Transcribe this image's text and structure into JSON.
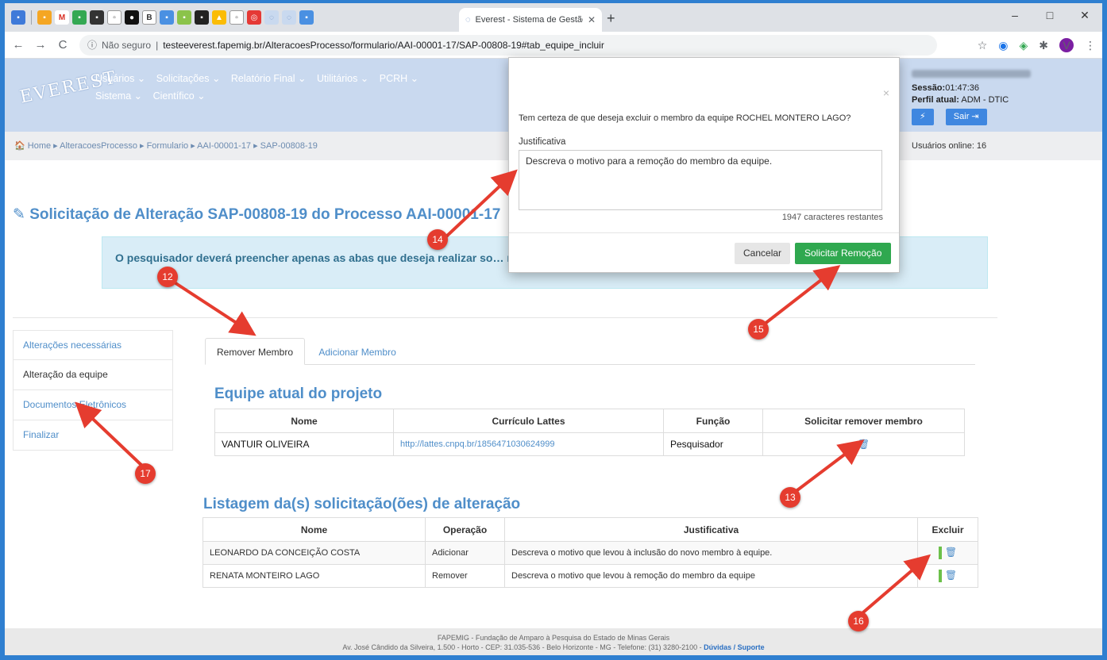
{
  "browser": {
    "active_tab_title": "Everest - Sistema de Gestão da F",
    "address_security": "Não seguro",
    "address_url": "testeeverest.fapemig.br/AlteracoesProcesso/formulario/AAI-00001-17/SAP-00808-19#tab_equipe_incluir",
    "profile_initial": "V",
    "new_tab": "+",
    "min": "–",
    "max": "□",
    "close": "✕"
  },
  "app": {
    "logo_text": "EVEREST",
    "menu_row1": [
      "Usuários ⌄",
      "Solicitações ⌄",
      "Relatório Final ⌄",
      "Utilitários ⌄",
      "PCRH ⌄"
    ],
    "menu_row2": [
      "Sistema ⌄",
      "Científico ⌄"
    ],
    "session_label": "Sessão:",
    "session_value": "01:47:36",
    "profile_label": "Perfil atual:",
    "profile_value": "ADM - DTIC",
    "bolt_button": "⚡",
    "logout_button": "Sair ⇥",
    "breadcrumb": "🏠 Home ▸ AlteracoesProcesso ▸ Formulario ▸ AAI-00001-17 ▸ SAP-00808-19",
    "online_users": "Usuários online: 16",
    "page_title": "✎ Solicitação de Alteração SAP-00808-19 do Processo AAI-00001-17",
    "alert_text": "O pesquisador deverá preencher apenas as abas que deseja realizar so… ma aba por solicitação de alteração."
  },
  "sidebar": {
    "items": [
      "Alterações necessárias",
      "Alteração da equipe",
      "Documentos Eletrônicos",
      "Finalizar"
    ]
  },
  "tabs": [
    "Remover Membro",
    "Adicionar Membro"
  ],
  "team": {
    "title": "Equipe atual do projeto",
    "headers": [
      "Nome",
      "Currículo Lattes",
      "Função",
      "Solicitar remover membro"
    ],
    "rows": [
      {
        "nome": "VANTUIR OLIVEIRA",
        "lattes": "http://lattes.cnpq.br/1856471030624999",
        "funcao": "Pesquisador"
      }
    ]
  },
  "requests": {
    "title": "Listagem da(s) solicitação(ões) de alteração",
    "headers": [
      "Nome",
      "Operação",
      "Justificativa",
      "Excluir"
    ],
    "rows": [
      {
        "nome": "LEONARDO DA CONCEIÇÃO COSTA",
        "op": "Adicionar",
        "just": "Descreva o motivo que levou à inclusão do novo membro à equipe."
      },
      {
        "nome": "RENATA MONTEIRO LAGO",
        "op": "Remover",
        "just": "Descreva o motivo que levou à remoção do membro da equipe"
      }
    ]
  },
  "footer": {
    "line1": "FAPEMIG - Fundação de Amparo à Pesquisa do Estado de Minas Gerais",
    "line2": "Av. José Cândido da Silveira, 1.500 - Horto - CEP: 31.035-536 - Belo Horizonte - MG - Telefone: (31) 3280-2100 -",
    "link": "Dúvidas / Suporte"
  },
  "modal": {
    "close": "×",
    "question": "Tem certeza de que deseja excluir o membro da equipe ROCHEL MONTERO LAGO?",
    "label": "Justificativa",
    "value": "Descreva o motivo para a remoção do membro da equipe.",
    "counter": "1947 caracteres restantes",
    "cancel": "Cancelar",
    "confirm": "Solicitar Remoção"
  },
  "annotations": [
    "12",
    "13",
    "14",
    "15",
    "16",
    "17"
  ],
  "colors": {
    "accent": "#4f8ec9",
    "success": "#2fa84f",
    "annotation": "#e53c2f"
  }
}
